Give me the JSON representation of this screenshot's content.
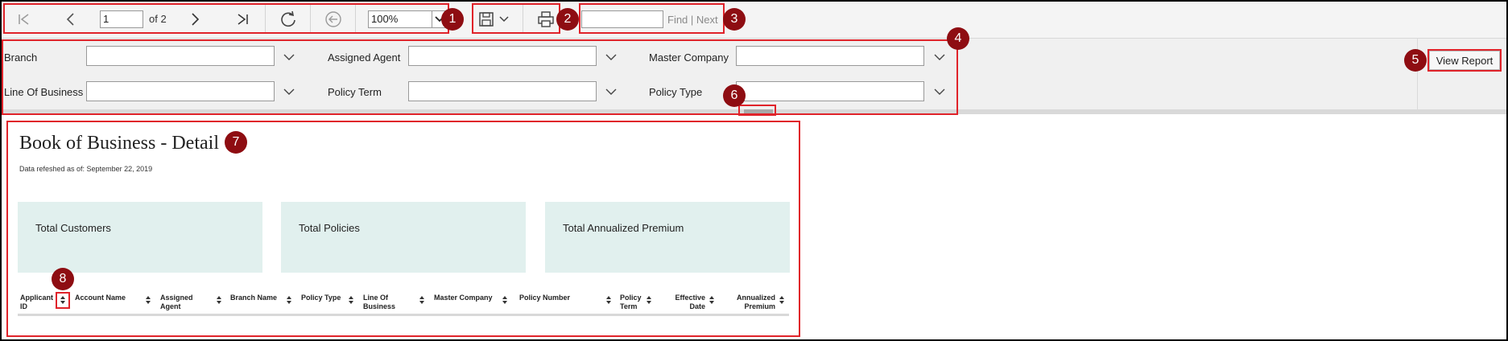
{
  "toolbar": {
    "page_current": "1",
    "page_of": "of 2",
    "zoom": "100%",
    "find_next": "Find | Next",
    "icons": [
      "first-page-icon",
      "previous-page-icon",
      "next-page-icon",
      "last-page-icon",
      "refresh-icon",
      "back-icon",
      "save-icon",
      "chevron-down-icon",
      "print-icon"
    ]
  },
  "params": {
    "branch": "Branch",
    "assigned_agent": "Assigned Agent",
    "master_company": "Master Company",
    "line_of_business": "Line Of Business",
    "policy_term": "Policy Term",
    "policy_type": "Policy Type",
    "view_report": "View Report"
  },
  "report": {
    "title": "Book of Business - Detail",
    "subtitle": "Data refeshed as of: September 22, 2019",
    "kpis": [
      "Total Customers",
      "Total Policies",
      "Total Annualized Premium"
    ],
    "columns": [
      {
        "l1": "Applicant",
        "l2": "ID"
      },
      {
        "l1": "Account Name",
        "l2": ""
      },
      {
        "l1": "Assigned",
        "l2": "Agent"
      },
      {
        "l1": "Branch Name",
        "l2": ""
      },
      {
        "l1": "Policy Type",
        "l2": ""
      },
      {
        "l1": "Line Of",
        "l2": "Business"
      },
      {
        "l1": "Master Company",
        "l2": ""
      },
      {
        "l1": "Policy Number",
        "l2": ""
      },
      {
        "l1": "Policy",
        "l2": "Term"
      },
      {
        "l1": "Effective",
        "l2": "Date"
      },
      {
        "l1": "Annualized",
        "l2": "Premium"
      }
    ]
  },
  "callouts": [
    "1",
    "2",
    "3",
    "4",
    "5",
    "6",
    "7",
    "8"
  ],
  "colors": {
    "accent_red": "#e0232a",
    "badge": "#8e0d12",
    "kpi_bg": "#e1f0ee"
  }
}
